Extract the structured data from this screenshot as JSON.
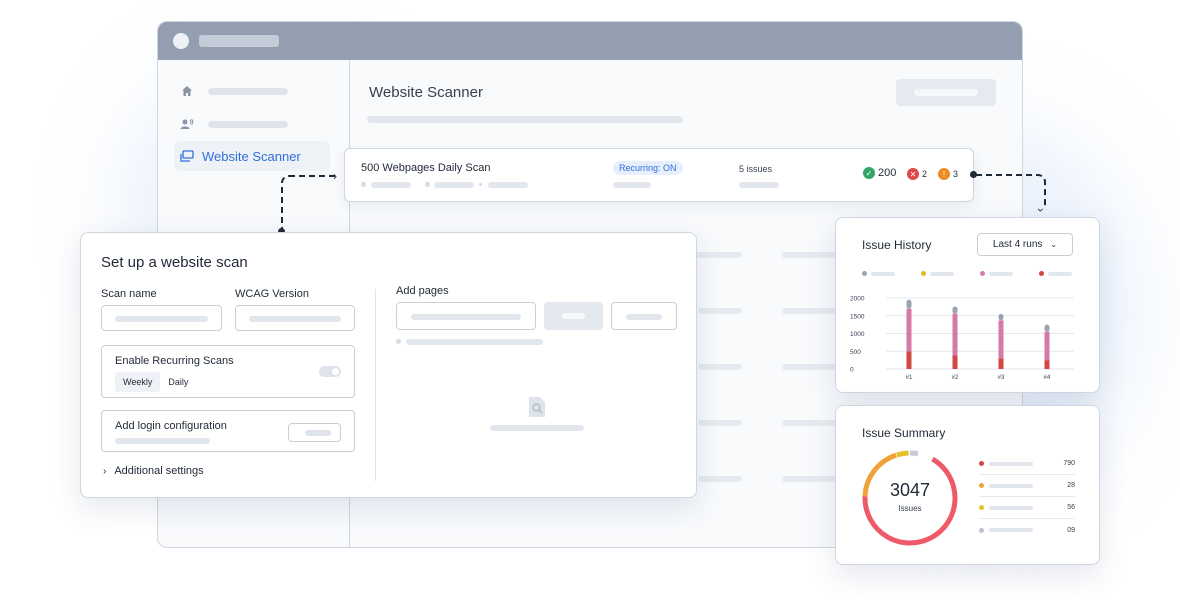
{
  "sidebar": {
    "items": [
      {
        "icon": "home-icon"
      },
      {
        "icon": "user-voice-icon"
      },
      {
        "icon": "website-scanner-icon",
        "label": "Website Scanner",
        "active": true
      }
    ]
  },
  "main": {
    "title": "Website Scanner"
  },
  "scan_row": {
    "name": "500 Webpages Daily Scan",
    "recurring_badge": "Recurring: ON",
    "issues": "5 issues",
    "passed": "200",
    "failed": "2",
    "warnings": "3"
  },
  "setup": {
    "title": "Set up a website scan",
    "scan_name_label": "Scan name",
    "wcag_label": "WCAG Version",
    "recurring_label": "Enable Recurring Scans",
    "weekly": "Weekly",
    "daily": "Daily",
    "login_label": "Add login configuration",
    "additional": "Additional settings",
    "add_pages_label": "Add pages"
  },
  "history": {
    "title": "Issue History",
    "range": "Last 4 runs"
  },
  "summary": {
    "title": "Issue Summary",
    "total": "3047",
    "total_label": "Issues",
    "rows": [
      {
        "value": "790",
        "color": "#d64545"
      },
      {
        "value": "28",
        "color": "#f0a23a"
      },
      {
        "value": "56",
        "color": "#e3c12b"
      },
      {
        "value": "09",
        "color": "#b9c2ce"
      }
    ]
  },
  "colors": {
    "accent": "#2f6fde",
    "pass": "#2fa56a",
    "fail": "#e04848",
    "warn": "#f08a24",
    "bar_top": "#9aa3b0",
    "bar_mid": "#d57aa8",
    "bar_base": "#d24646"
  },
  "chart_data": {
    "type": "bar",
    "categories": [
      "#1",
      "#2",
      "#3",
      "#4"
    ],
    "series": [
      {
        "values": [
          500,
          380,
          300,
          250
        ]
      },
      {
        "values": [
          1200,
          1180,
          1070,
          800
        ]
      },
      {
        "values": [
          250,
          200,
          180,
          200
        ]
      }
    ],
    "yticks": [
      "2000",
      "1500",
      "1000",
      "500",
      "0"
    ],
    "ylim": [
      0,
      2000
    ],
    "stacked": true
  }
}
